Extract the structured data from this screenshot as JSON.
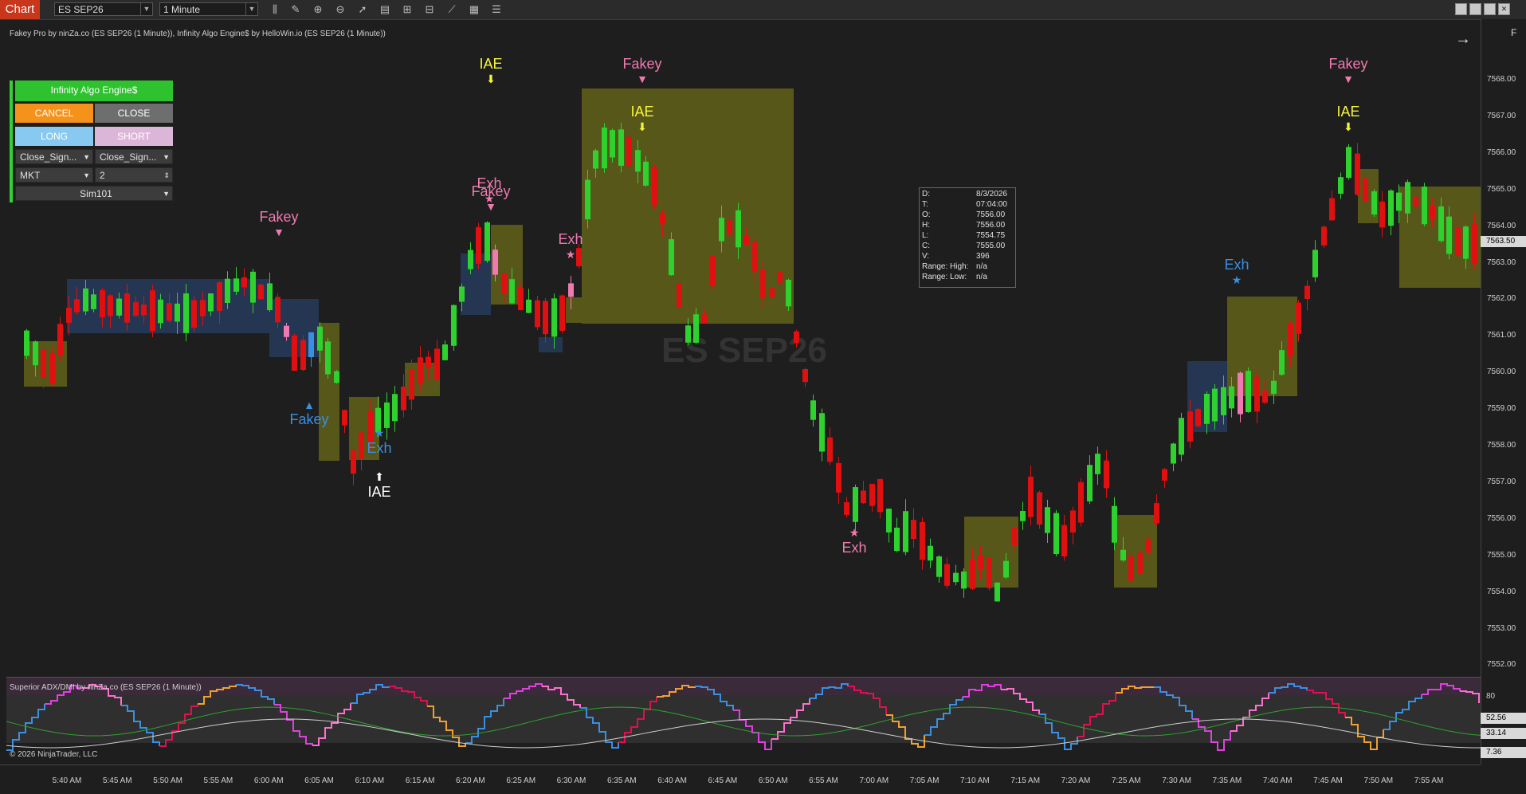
{
  "toolbar": {
    "tab": "Chart",
    "instrument": "ES SEP26",
    "interval": "1 Minute",
    "icons": [
      "bar-type-icon",
      "draw-icon",
      "zoom-in-icon",
      "zoom-out-icon",
      "pointer-icon",
      "data-box-icon",
      "properties-icon",
      "templates-icon",
      "strategies-icon",
      "indicators-icon",
      "list-icon"
    ],
    "window_icons": [
      "restore-icon",
      "minimize-icon",
      "maximize-icon",
      "close-icon"
    ]
  },
  "chart": {
    "title": "Fakey Pro by ninZa.co (ES SEP26 (1 Minute)), Infinity Algo Engine$ by HelloWin.io (ES SEP26 (1 Minute))",
    "watermark": "ES SEP26",
    "f_button": "F"
  },
  "panel": {
    "title": "Infinity Algo Engine$",
    "cancel": "CANCEL",
    "close": "CLOSE",
    "long": "LONG",
    "short": "SHORT",
    "select_left": "Close_Sign...",
    "select_right": "Close_Sign...",
    "order_type": "MKT",
    "quantity": "2",
    "account": "Sim101"
  },
  "databox": {
    "rows": [
      {
        "k": "D:",
        "v": "8/3/2026"
      },
      {
        "k": "T:",
        "v": "07:04:00"
      },
      {
        "k": "O:",
        "v": "7556.00"
      },
      {
        "k": "H:",
        "v": "7556.00"
      },
      {
        "k": "L:",
        "v": "7554.75"
      },
      {
        "k": "C:",
        "v": "7555.00"
      },
      {
        "k": "V:",
        "v": "396"
      },
      {
        "k": "Range: High:",
        "v": "n/a"
      },
      {
        "k": "Range: Low:",
        "v": "n/a"
      }
    ]
  },
  "price_axis": {
    "ticks": [
      "7568.00",
      "7567.00",
      "7566.00",
      "7565.00",
      "7564.00",
      "7563.00",
      "7562.00",
      "7561.00",
      "7560.00",
      "7559.00",
      "7558.00",
      "7557.00",
      "7556.00",
      "7555.00",
      "7554.00",
      "7553.00",
      "7552.00"
    ],
    "current_price": "7563.50"
  },
  "time_axis": {
    "ticks": [
      "5:40 AM",
      "5:45 AM",
      "5:50 AM",
      "5:55 AM",
      "6:00 AM",
      "6:05 AM",
      "6:10 AM",
      "6:15 AM",
      "6:20 AM",
      "6:25 AM",
      "6:30 AM",
      "6:35 AM",
      "6:40 AM",
      "6:45 AM",
      "6:50 AM",
      "6:55 AM",
      "7:00 AM",
      "7:05 AM",
      "7:10 AM",
      "7:15 AM",
      "7:20 AM",
      "7:25 AM",
      "7:30 AM",
      "7:35 AM",
      "7:40 AM",
      "7:45 AM",
      "7:50 AM",
      "7:55 AM"
    ]
  },
  "signals": [
    {
      "text": "Fakey",
      "arrow": "▼",
      "color": "#f07ab0",
      "kind": "fakey-bear"
    },
    {
      "text": "Fakey",
      "arrow": "▲",
      "color": "#3b8fe0",
      "kind": "fakey-bull"
    },
    {
      "text": "Exh",
      "arrow": "★",
      "color": "#3b8fe0",
      "kind": "exh-bull"
    },
    {
      "text": "IAE",
      "arrow": "⬆",
      "color": "#ffffff",
      "kind": "iae-bull"
    },
    {
      "text": "IAE",
      "arrow": "⬇",
      "color": "#f5f53b",
      "kind": "iae-bear"
    },
    {
      "text": "Fakey",
      "arrow": "▼",
      "color": "#f07ab0",
      "kind": "fakey-bear"
    },
    {
      "text": "Exh",
      "arrow": "★",
      "color": "#f07ab0",
      "kind": "exh-bear"
    },
    {
      "text": "Fakey",
      "arrow": "▼",
      "color": "#f07ab0",
      "kind": "fakey-bear"
    },
    {
      "text": "IAE",
      "arrow": "⬇",
      "color": "#f5f53b",
      "kind": "iae-bear"
    },
    {
      "text": "Exh",
      "arrow": "★",
      "color": "#f07ab0",
      "kind": "exh-bear"
    },
    {
      "text": "Exh",
      "arrow": "★",
      "color": "#3b8fe0",
      "kind": "exh-bull"
    },
    {
      "text": "Fakey",
      "arrow": "▼",
      "color": "#f07ab0",
      "kind": "fakey-bear"
    },
    {
      "text": "IAE",
      "arrow": "⬇",
      "color": "#f5f53b",
      "kind": "iae-bear"
    },
    {
      "text": "Exh",
      "arrow": "★",
      "color": "#f07ab0",
      "kind": "exh-bear"
    }
  ],
  "adx": {
    "title": "Superior ADX/DMI by ninZa.co (ES SEP26 (1 Minute))",
    "copyright": "© 2026 NinjaTrader, LLC",
    "level_label": "80",
    "value1": "52.56",
    "value2": "33.14",
    "value3": "7.36"
  },
  "colors": {
    "up": "#2fd12f",
    "down": "#e01010",
    "fakey_pink": "#f07ab0",
    "fakey_blue": "#3b8fe0",
    "iae_yellow": "#f5f53b",
    "zone_olive": "#6b6b1a",
    "zone_navy": "#263b5c"
  }
}
